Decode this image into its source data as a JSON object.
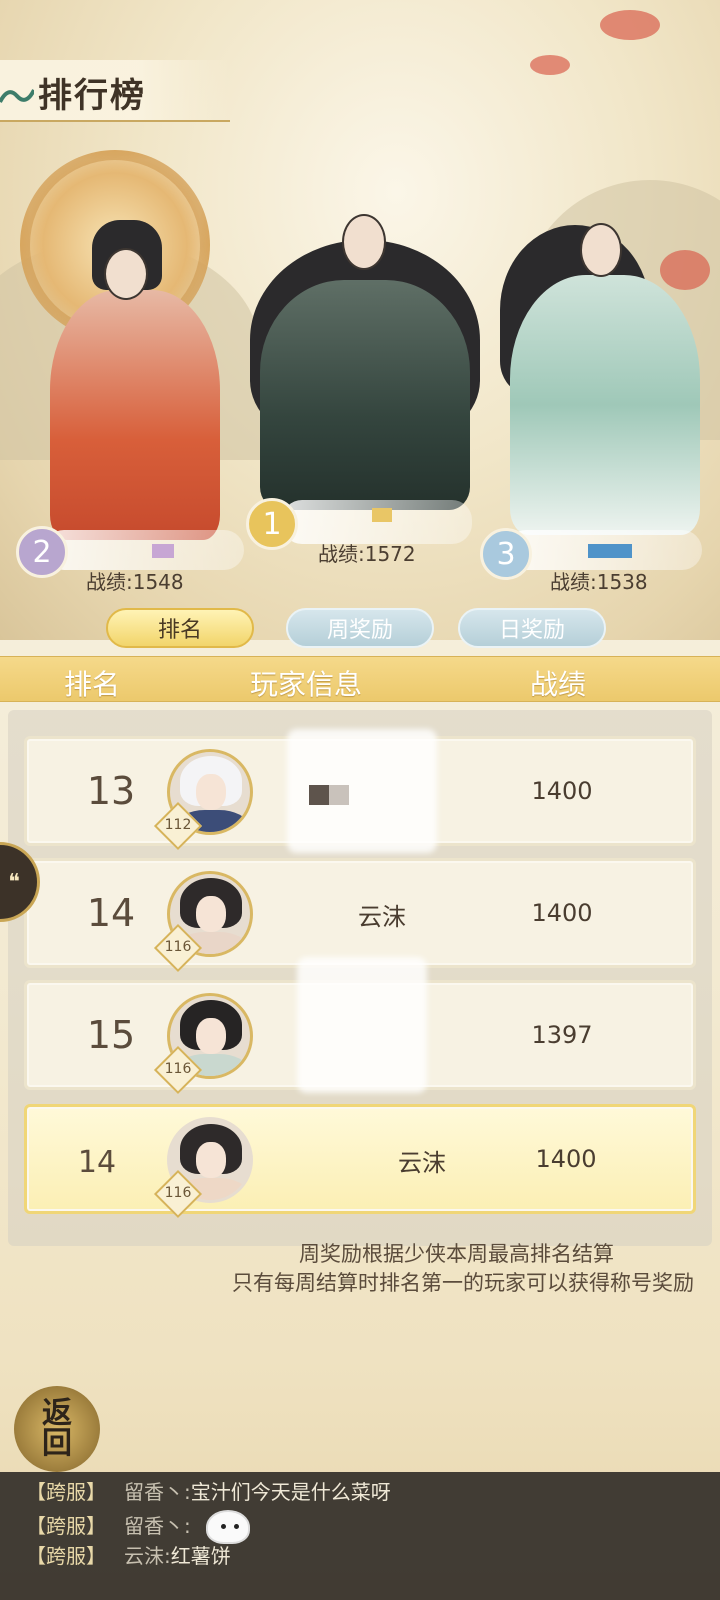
{
  "header": {
    "title": "排行榜"
  },
  "podium": [
    {
      "rank": "2",
      "score": "战绩:1548",
      "name_color": "#c7a6d4",
      "circle_color": "#b8a6cf"
    },
    {
      "rank": "1",
      "score": "战绩:1572",
      "name_color": "#e9c666",
      "circle_color": "#e8c45c"
    },
    {
      "rank": "3",
      "score": "战绩:1538",
      "name_color": "#4f93c9",
      "circle_color": "#a9c9de"
    }
  ],
  "tabs": [
    {
      "label": "排名",
      "active": true
    },
    {
      "label": "周奖励",
      "active": false
    },
    {
      "label": "日奖励",
      "active": false
    }
  ],
  "table": {
    "columns": [
      "排名",
      "玩家信息",
      "战绩"
    ],
    "rows": [
      {
        "rank": "13",
        "level": "112",
        "name": "",
        "score": "1400"
      },
      {
        "rank": "14",
        "level": "116",
        "name": "云沫",
        "score": "1400"
      },
      {
        "rank": "15",
        "level": "116",
        "name": "",
        "score": "1397"
      }
    ],
    "my_row": {
      "rank": "14",
      "level": "116",
      "name": "云沫",
      "score": "1400"
    }
  },
  "notice": [
    "周奖励根据少侠本周最高排名结算",
    "只有每周结算时排名第一的玩家可以获得称号奖励"
  ],
  "back_button": {
    "line1": "返",
    "line2": "回"
  },
  "chat": [
    {
      "channel": "【跨服】",
      "speaker": "留香丶:",
      "message": "宝汁们今天是什么菜呀"
    },
    {
      "channel": "【跨服】",
      "speaker": "留香丶:",
      "message": ""
    },
    {
      "channel": "【跨服】",
      "speaker": "云沫:",
      "message": "红薯饼"
    }
  ],
  "colors": {
    "accent_gold": "#ecc96c",
    "tab_blue": "#b5cfd8",
    "chat_bg": "#342f2a"
  },
  "icons": {
    "side_tab": "chat-bubble-icon",
    "sticker": "sticker-icon",
    "wave": "wave-icon"
  }
}
